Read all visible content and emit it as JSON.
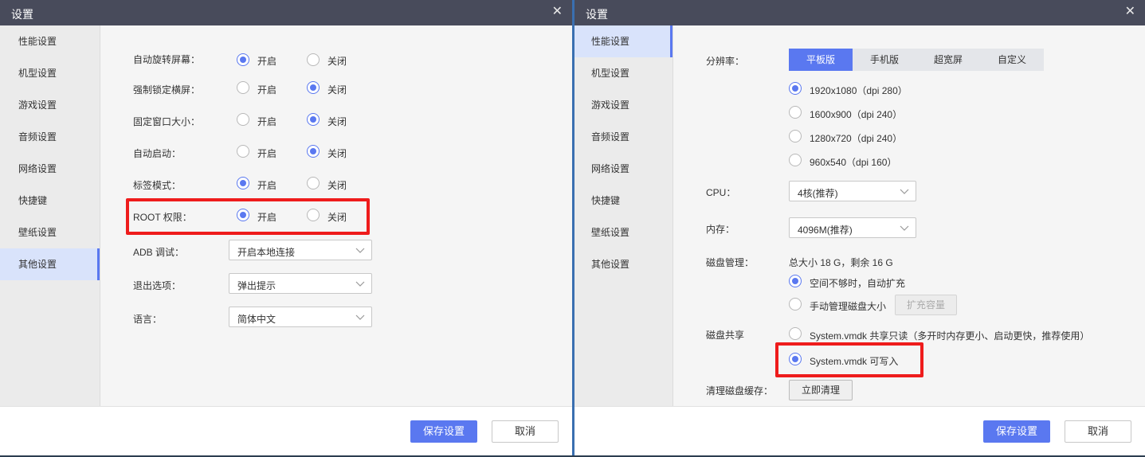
{
  "left": {
    "title": "设置",
    "sidebar": [
      "性能设置",
      "机型设置",
      "游戏设置",
      "音频设置",
      "网络设置",
      "快捷键",
      "壁纸设置",
      "其他设置"
    ],
    "radio_rows": [
      {
        "label": "自动旋转屏幕：",
        "on": "开启",
        "off": "关闭"
      },
      {
        "label": "强制锁定横屏：",
        "on": "开启",
        "off": "关闭"
      },
      {
        "label": "固定窗口大小：",
        "on": "开启",
        "off": "关闭"
      },
      {
        "label": "自动启动：",
        "on": "开启",
        "off": "关闭"
      },
      {
        "label": "标签模式：",
        "on": "开启",
        "off": "关闭"
      },
      {
        "label": "ROOT 权限：",
        "on": "开启",
        "off": "关闭"
      }
    ],
    "selects": [
      {
        "label": "ADB 调试：",
        "value": "开启本地连接"
      },
      {
        "label": "退出选项：",
        "value": "弹出提示"
      },
      {
        "label": "语言：",
        "value": "简体中文"
      }
    ],
    "save": "保存设置",
    "cancel": "取消"
  },
  "right": {
    "title": "设置",
    "sidebar": [
      "性能设置",
      "机型设置",
      "游戏设置",
      "音频设置",
      "网络设置",
      "快捷键",
      "壁纸设置",
      "其他设置"
    ],
    "resolution_label": "分辨率：",
    "tabs": [
      "平板版",
      "手机版",
      "超宽屏",
      "自定义"
    ],
    "resolutions": [
      "1920x1080（dpi 280）",
      "1600x900（dpi 240）",
      "1280x720（dpi 240）",
      "960x540（dpi 160）"
    ],
    "cpu_label": "CPU：",
    "cpu_value": "4核(推荐)",
    "mem_label": "内存：",
    "mem_value": "4096M(推荐)",
    "disk_label": "磁盘管理：",
    "disk_info": "总大小 18 G，剩余 16 G",
    "disk_opts": [
      "空间不够时，自动扩充",
      "手动管理磁盘大小"
    ],
    "expand_btn": "扩充容量",
    "share_label": "磁盘共享",
    "share_opts": [
      "System.vmdk 共享只读（多开时内存更小、启动更快，推荐使用）",
      "System.vmdk 可写入"
    ],
    "cache_label": "清理磁盘缓存：",
    "cache_btn": "立即清理",
    "save": "保存设置",
    "cancel": "取消"
  }
}
